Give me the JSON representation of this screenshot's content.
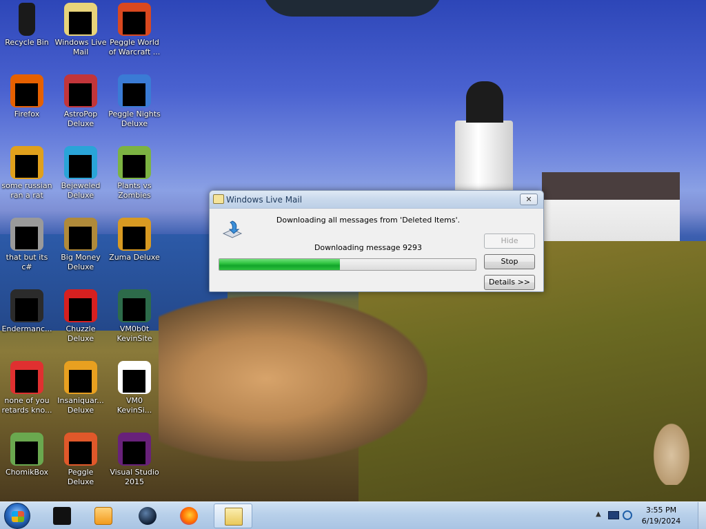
{
  "desktop_icons": [
    {
      "label": "Recycle Bin",
      "icon": "recycle-bin-icon",
      "masked": false,
      "color": "#1a1a1a"
    },
    {
      "label": "Windows Live Mail",
      "icon": "windows-live-mail-icon",
      "masked": true,
      "color": "#e8d47a"
    },
    {
      "label": "Peggle World of Warcraft ...",
      "icon": "peggle-wow-icon",
      "masked": true,
      "color": "#d9481f"
    },
    {
      "label": "Firefox",
      "icon": "firefox-icon",
      "masked": true,
      "color": "#e66000"
    },
    {
      "label": "AstroPop Deluxe",
      "icon": "astropop-icon",
      "masked": true,
      "color": "#c2353a"
    },
    {
      "label": "Peggle Nights Deluxe",
      "icon": "peggle-nights-icon",
      "masked": true,
      "color": "#3a7bd5"
    },
    {
      "label": "some russian ran a rat",
      "icon": "russian-rat-icon",
      "masked": true,
      "color": "#e0a01c"
    },
    {
      "label": "Bejeweled Deluxe",
      "icon": "bejeweled-icon",
      "masked": true,
      "color": "#2aa4d8"
    },
    {
      "label": "Plants vs Zombies",
      "icon": "plants-vs-zombies-icon",
      "masked": true,
      "color": "#7cb342"
    },
    {
      "label": "that but its c#",
      "icon": "csharp-shortcut-icon",
      "masked": true,
      "color": "#9a9a9a"
    },
    {
      "label": "Big Money Deluxe",
      "icon": "big-money-icon",
      "masked": true,
      "color": "#b08a3a"
    },
    {
      "label": "Zuma Deluxe",
      "icon": "zuma-icon",
      "masked": true,
      "color": "#d89a22"
    },
    {
      "label": "Endermanc...",
      "icon": "endermanch-icon",
      "masked": true,
      "color": "#2b2b2b"
    },
    {
      "label": "Chuzzle Deluxe",
      "icon": "chuzzle-icon",
      "masked": true,
      "color": "#d62020"
    },
    {
      "label": "VM0b0t KevinSite",
      "icon": "vm0b0t-icon",
      "masked": true,
      "color": "#2d6b4a"
    },
    {
      "label": "none of you retards kno...",
      "icon": "opera-shortcut-icon",
      "masked": true,
      "color": "#e03030"
    },
    {
      "label": "Insaniquar... Deluxe",
      "icon": "insaniquarium-icon",
      "masked": true,
      "color": "#e8a020"
    },
    {
      "label": "VM0 KevinSi...",
      "icon": "vm0-document-icon",
      "masked": true,
      "color": "#ffffff"
    },
    {
      "label": "ChomikBox",
      "icon": "chomikbox-icon",
      "masked": true,
      "color": "#6aa84f"
    },
    {
      "label": "Peggle Deluxe",
      "icon": "peggle-deluxe-icon",
      "masked": true,
      "color": "#e0582a"
    },
    {
      "label": "Visual Studio 2015",
      "icon": "visual-studio-icon",
      "masked": true,
      "color": "#68217a"
    }
  ],
  "dialog": {
    "title": "Windows Live Mail",
    "status_line": "Downloading all messages from 'Deleted Items'.",
    "progress_line": "Downloading message 9293",
    "progress_fraction": 0.47,
    "hide_label": "Hide",
    "stop_label": "Stop",
    "details_label": "Details >>",
    "close_glyph": "✕",
    "accent": "#2fc440"
  },
  "taskbar": {
    "items": [
      {
        "name": "start-button",
        "icon": "windows-orb-icon"
      },
      {
        "name": "taskbar-item-black-app",
        "icon": "black-device-icon"
      },
      {
        "name": "taskbar-item-media-player",
        "icon": "media-player-icon"
      },
      {
        "name": "taskbar-item-globe-browser",
        "icon": "globe-icon"
      },
      {
        "name": "taskbar-item-firefox",
        "icon": "firefox-icon"
      },
      {
        "name": "taskbar-item-windows-live-mail",
        "icon": "windows-live-mail-icon",
        "active": true
      }
    ],
    "tray_arrow": "▲",
    "time": "3:55 PM",
    "date": "6/19/2024"
  }
}
